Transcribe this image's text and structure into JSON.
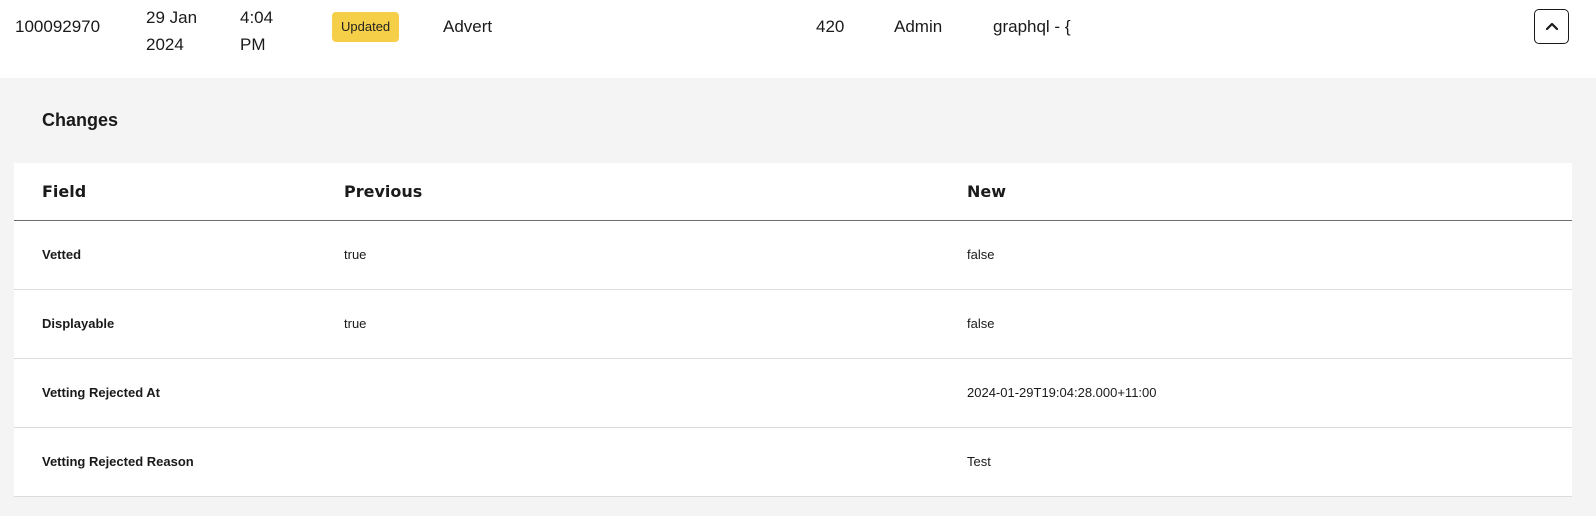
{
  "record": {
    "id": "100092970",
    "date_line1": "29 Jan",
    "date_line2": "2024",
    "time_line1": "4:04",
    "time_line2": "PM",
    "action_badge": "Updated",
    "entity_type": "Advert",
    "number": "420",
    "user": "Admin",
    "source": "graphql - {",
    "toggle_icon": "chevron-up-icon"
  },
  "changes": {
    "title": "Changes",
    "columns": [
      "Field",
      "Previous",
      "New"
    ],
    "rows": [
      {
        "field": "Vetted",
        "previous": "true",
        "new": "false"
      },
      {
        "field": "Displayable",
        "previous": "true",
        "new": "false"
      },
      {
        "field": "Vetting Rejected At",
        "previous": "",
        "new": "2024-01-29T19:04:28.000+11:00"
      },
      {
        "field": "Vetting Rejected Reason",
        "previous": "",
        "new": "Test"
      }
    ]
  },
  "colors": {
    "badge_bg": "#f5cf47",
    "panel_bg": "#f4f4f4",
    "row_bg": "#ffffff"
  }
}
